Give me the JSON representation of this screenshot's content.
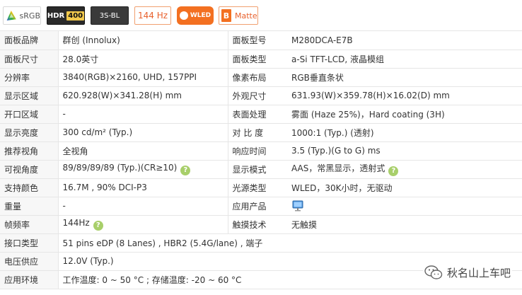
{
  "badges": {
    "srgb": "sRGB",
    "hdr": "HDR",
    "hdr_num": "400",
    "threes": "3S-BL",
    "hz": "144 Hz",
    "wled": "WLED",
    "matte_letter": "B",
    "matte": "Matte"
  },
  "rows": [
    {
      "l1": "面板品牌",
      "v1": "群创 (Innolux)",
      "l2": "面板型号",
      "v2": "M280DCA-E7B"
    },
    {
      "l1": "面板尺寸",
      "v1": "28.0英寸",
      "l2": "面板类型",
      "v2": "a-Si TFT-LCD, 液晶模组"
    },
    {
      "l1": "分辨率",
      "v1": "3840(RGB)×2160, UHD, 157PPI",
      "l2": "像素布局",
      "v2": "RGB垂直条状"
    },
    {
      "l1": "显示区域",
      "v1": "620.928(W)×341.28(H) mm",
      "l2": "外观尺寸",
      "v2": "631.93(W)×359.78(H)×16.02(D) mm"
    },
    {
      "l1": "开口区域",
      "v1": "-",
      "l2": "表面处理",
      "v2": "雾面 (Haze 25%)，Hard coating (3H)"
    },
    {
      "l1": "显示亮度",
      "v1": "300 cd/m² (Typ.)",
      "l2": "对 比 度",
      "v2": "1000:1 (Typ.) (透射)"
    },
    {
      "l1": "推荐视角",
      "v1": "全视角",
      "l2": "响应时间",
      "v2": "3.5 (Typ.)(G to G) ms"
    },
    {
      "l1": "可视角度",
      "v1": "89/89/89/89 (Typ.)(CR≥10)",
      "l2": "显示模式",
      "v2": "AAS，常黑显示，透射式"
    },
    {
      "l1": "支持颜色",
      "v1": "16.7M , 90% DCI-P3",
      "l2": "光源类型",
      "v2": "WLED，30K小时，无驱动"
    },
    {
      "l1": "重量",
      "v1": "-",
      "l2": "应用产品",
      "v2": ""
    },
    {
      "l1": "帧频率",
      "v1": "144Hz",
      "l2": "触摸技术",
      "v2": "无触摸"
    },
    {
      "l1": "接口类型",
      "v1": "51 pins   eDP (8 Lanes) , HBR2 (5.4G/lane) , 端子"
    },
    {
      "l1": "电压供应",
      "v1": "12.0V (Typ.)"
    },
    {
      "l1": "应用环境",
      "v1": "工作温度: 0 ~ 50 °C ; 存储温度: -20 ~ 60 °C"
    }
  ],
  "help_glyph": "?",
  "watermark": "秋名山上车吧",
  "colors": {
    "accent": "#f37021",
    "help": "#a8cf6a",
    "label_bg": "#f7f7f7"
  }
}
